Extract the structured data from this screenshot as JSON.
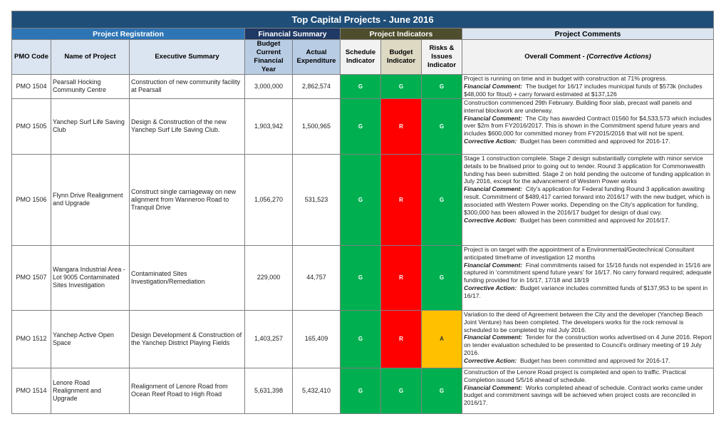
{
  "title": "Top Capital Projects - June 2016",
  "groups": {
    "registration": "Project Registration",
    "financial": "Financial Summary",
    "indicators": "Project Indicators",
    "comments": "Project Comments"
  },
  "headers": {
    "pmo_code": "PMO Code",
    "name": "Name of Project",
    "summary": "Executive Summary",
    "budget": "Budget Current Financial Year",
    "actual": "Actual Expenditure",
    "schedule": "Schedule Indicator",
    "budget_ind": "Budget Indicator",
    "risk": "Risks & Issues Indicator",
    "comment_main": "Overall Comment - ",
    "comment_hint": "(Corrective Actions)"
  },
  "labels": {
    "financial": "Financial Comment:",
    "corrective": "Corrective Action:"
  },
  "colors": {
    "G": "#00b050",
    "R": "#ff0000",
    "A": "#ffc000"
  },
  "rows": [
    {
      "code": "PMO 1504",
      "name": "Pearsall Hocking Community Centre",
      "summary": "Construction of new community facility at Pearsall",
      "budget": "3,000,000",
      "actual": "2,862,574",
      "schedule": "G",
      "budget_ind": "G",
      "risk": "G",
      "overall": "Project is running on time and in budget with construction at 71% progress.",
      "financial": "The budget for 16/17 includes municipal funds of $573k (includes $48,000 for fitout) + carry forward estimated at $137,126",
      "corrective": ""
    },
    {
      "code": "PMO 1505",
      "name": "Yanchep Surf Life Saving Club",
      "summary": "Design & Construction of the new Yanchep Surf Life Saving Club.",
      "budget": "1,903,942",
      "actual": "1,500,965",
      "schedule": "G",
      "budget_ind": "R",
      "risk": "G",
      "overall": "Construction commenced 29th February. Building floor slab, precast wall panels and internal blockwork are underway.",
      "financial": "The City has awarded Contract 01560 for $4,533,573 which includes over $2m from FY2016/2017.  This is shown in the Commitment spend future years and includes $600,000 for committed money from FY2015/2016 that will not be spent.",
      "corrective": "Budget has been committed and approved for 2016-17."
    },
    {
      "code": "PMO 1506",
      "name": "Flynn Drive Realignment and Upgrade",
      "summary": "Construct single carriageway on new alignment from Wanneroo Road to Tranquil Drive",
      "budget": "1,056,270",
      "actual": "531,523",
      "schedule": "G",
      "budget_ind": "R",
      "risk": "G",
      "overall": "Stage 1 construction complete.  Stage 2 design substantially complete with minor service details to be finalised prior to going out to tender. Round 3 application for Commonwealth funding has been submitted. Stage 2 on hold pending the outcome of funding application in July 2016, except for the advancement of Western Power works",
      "financial": "City's application for Federal funding Round 3 application awaiting result. Commitment of $489,417 carried forward into 2016/17 with the new budget, which is associated with Western Power works. Depending on the City's application for funding, $300,000 has been allowed in the 2016/17 budget for design of dual cwy.",
      "corrective": "Budget has been committed and approved for 2016/17."
    },
    {
      "code": "PMO 1507",
      "name": "Wangara Industrial Area - Lot 9005 Contaminated Sites Investigation",
      "summary": "Contaminated Sites Investigation/Remediation",
      "budget": "229,000",
      "actual": "44,757",
      "schedule": "G",
      "budget_ind": "R",
      "risk": "G",
      "overall": "Project is on target with the appointment of a Environmental/Geotechnical Consultant anticipated timeframe of investigation 12 months",
      "financial": "Final commitments raised for 15/16 funds not expended in 15/16 are captured in 'commitment spend future years' for 16/17.  No carry forward required; adequate funding provided for in 16/17, 17/18 and 18/19",
      "corrective": "Budget variance includes committed funds of $137,953 to be spent in 16/17."
    },
    {
      "code": "PMO 1512",
      "name": "Yanchep Active Open Space",
      "summary": "Design Development & Construction of the Yanchep District Playing Fields",
      "budget": "1,403,257",
      "actual": "165,409",
      "schedule": "G",
      "budget_ind": "R",
      "risk": "A",
      "overall": "Variation to the deed of Agreement between the City and the developer (Yanchep Beach Joint Venture) has been completed.  The developers works for the rock removal is scheduled to  be completed by mid July 2016.",
      "financial": "Tender for the construction works advertised on 4 June 2016. Report on tender evaluation scheduled to be presented to Council's ordinary meeting of 19 July 2016.",
      "corrective": "Budget has been committed and approved for 2016-17."
    },
    {
      "code": "PMO 1514",
      "name": "Lenore Road Realignment and Upgrade",
      "summary": "Realignment of Lenore Road from Ocean Reef Road to High Road",
      "budget": "5,631,398",
      "actual": "5,432,410",
      "schedule": "G",
      "budget_ind": "G",
      "risk": "G",
      "overall": "Construction of the Lenore Road project is completed and open to traffic.  Practical Completion issued 5/5/16 ahead of schedule.",
      "financial": "Works completed ahead of schedule. Contract works came under budget and commitment savings will be achieved when project costs are reconciled in 2016/17.",
      "corrective": ""
    }
  ]
}
